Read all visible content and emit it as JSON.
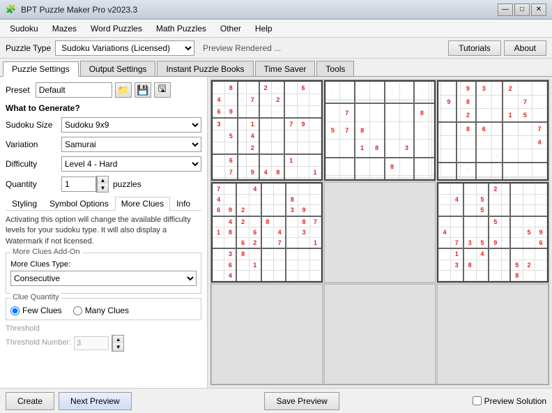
{
  "app": {
    "title": "BPT Puzzle Maker Pro v2023.3",
    "icon": "🧩"
  },
  "title_buttons": {
    "minimize": "—",
    "maximize": "□",
    "close": "✕"
  },
  "menu": {
    "items": [
      "Sudoku",
      "Mazes",
      "Word Puzzles",
      "Math Puzzles",
      "Other",
      "Help"
    ]
  },
  "toolbar": {
    "puzzle_type_label": "Puzzle Type",
    "puzzle_type_value": "Sudoku Variations (Licensed)",
    "preview_label": "Preview Rendered ...",
    "tutorials_label": "Tutorials",
    "about_label": "About"
  },
  "tabs": {
    "items": [
      "Puzzle Settings",
      "Output Settings",
      "Instant Puzzle Books",
      "Time Saver",
      "Tools"
    ],
    "active": 0
  },
  "left_panel": {
    "preset_label": "Preset",
    "preset_value": "Default",
    "what_to_generate": "What to Generate?",
    "sudoku_size_label": "Sudoku Size",
    "sudoku_size_value": "Sudoku  9x9",
    "variation_label": "Variation",
    "variation_value": "Samurai",
    "difficulty_label": "Difficulty",
    "difficulty_value": "Level 4 - Hard",
    "quantity_label": "Quantity",
    "quantity_value": "1",
    "quantity_unit": "puzzles",
    "sub_tabs": [
      "Styling",
      "Symbol Options",
      "More Clues",
      "Info"
    ],
    "active_sub_tab": 2,
    "info_text": "Activating this option will change the available difficulty levels for your sudoku type. It will also display a Watermark if not licensed.",
    "more_clues_addon_title": "More Clues Add-On",
    "clues_type_label": "More Clues Type:",
    "clues_type_value": "Consecutive",
    "clue_quantity_title": "Clue Quantity",
    "few_clues_label": "Few Clues",
    "many_clues_label": "Many Clues",
    "threshold_title": "Threshold",
    "threshold_label": "Threshold Number:",
    "threshold_value": "3"
  },
  "bottom": {
    "create_label": "Create",
    "next_preview_label": "Next Preview",
    "save_preview_label": "Save Preview",
    "preview_solution_label": "Preview Solution"
  },
  "puzzle_grid": {
    "cells": [
      [
        "",
        "8",
        "",
        "",
        "2",
        "",
        "",
        "6",
        ""
      ],
      [
        "4",
        "",
        "",
        "7",
        "",
        "2",
        "",
        "",
        ""
      ],
      [
        "6",
        "9",
        "",
        "",
        "",
        "",
        "",
        "",
        ""
      ],
      [
        "3",
        "",
        "",
        "1",
        "",
        "",
        "7",
        "9",
        ""
      ],
      [
        "",
        "5",
        "",
        "4",
        "",
        "",
        "",
        "",
        ""
      ],
      [
        "",
        "",
        "",
        "2",
        "",
        "",
        "",
        "",
        ""
      ],
      [
        "",
        "6",
        "",
        "",
        "",
        "",
        "1",
        "",
        ""
      ],
      [
        "",
        "7",
        "",
        "9",
        "4",
        "8",
        "",
        "",
        "1"
      ],
      [
        "",
        "",
        "",
        "",
        "",
        "",
        "",
        "",
        ""
      ]
    ]
  }
}
